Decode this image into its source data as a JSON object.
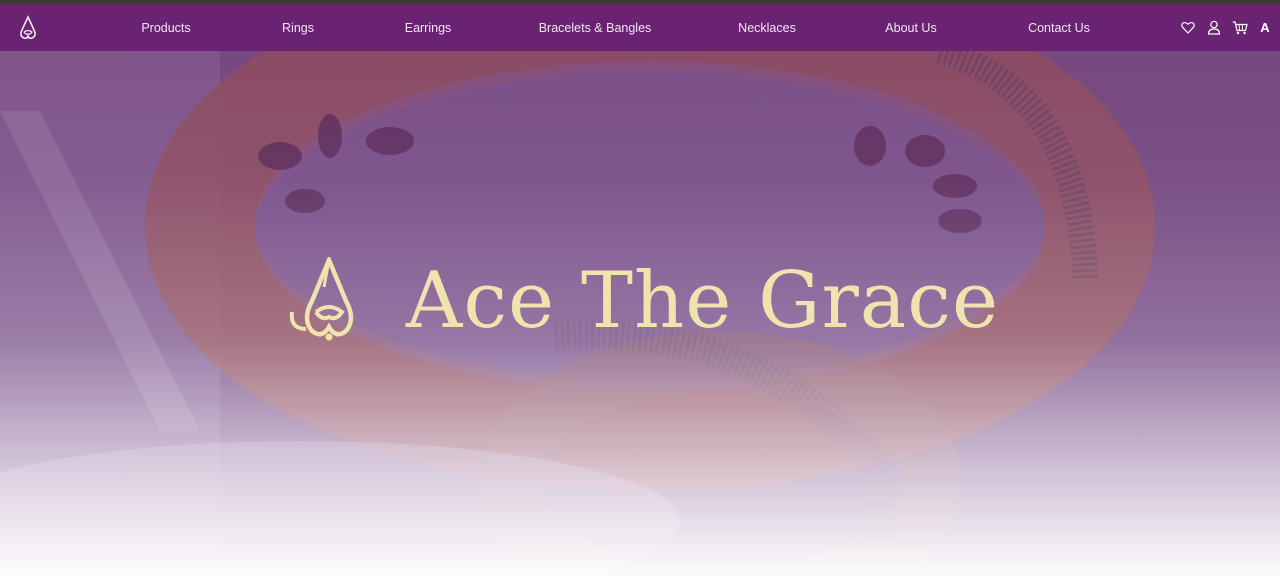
{
  "nav": {
    "logo_icon": "ace-the-grace-logo-icon",
    "links": [
      {
        "label": "Products"
      },
      {
        "label": "Rings"
      },
      {
        "label": "Earrings"
      },
      {
        "label": "Bracelets & Bangles"
      },
      {
        "label": "Necklaces"
      },
      {
        "label": "About Us"
      },
      {
        "label": "Contact Us"
      }
    ],
    "icons": [
      "heart-icon",
      "user-icon",
      "cart-icon"
    ],
    "language_label": "A"
  },
  "hero": {
    "brand_name": "Ace The Grace",
    "brand_mark_icon": "ace-the-grace-logo-icon",
    "background_subject": "bangle-photo"
  },
  "colors": {
    "nav_background": "#6a2372",
    "nav_text": "#f1e6f2",
    "brand_gold": "#efe4ae",
    "top_strip": "#3b3b33"
  }
}
